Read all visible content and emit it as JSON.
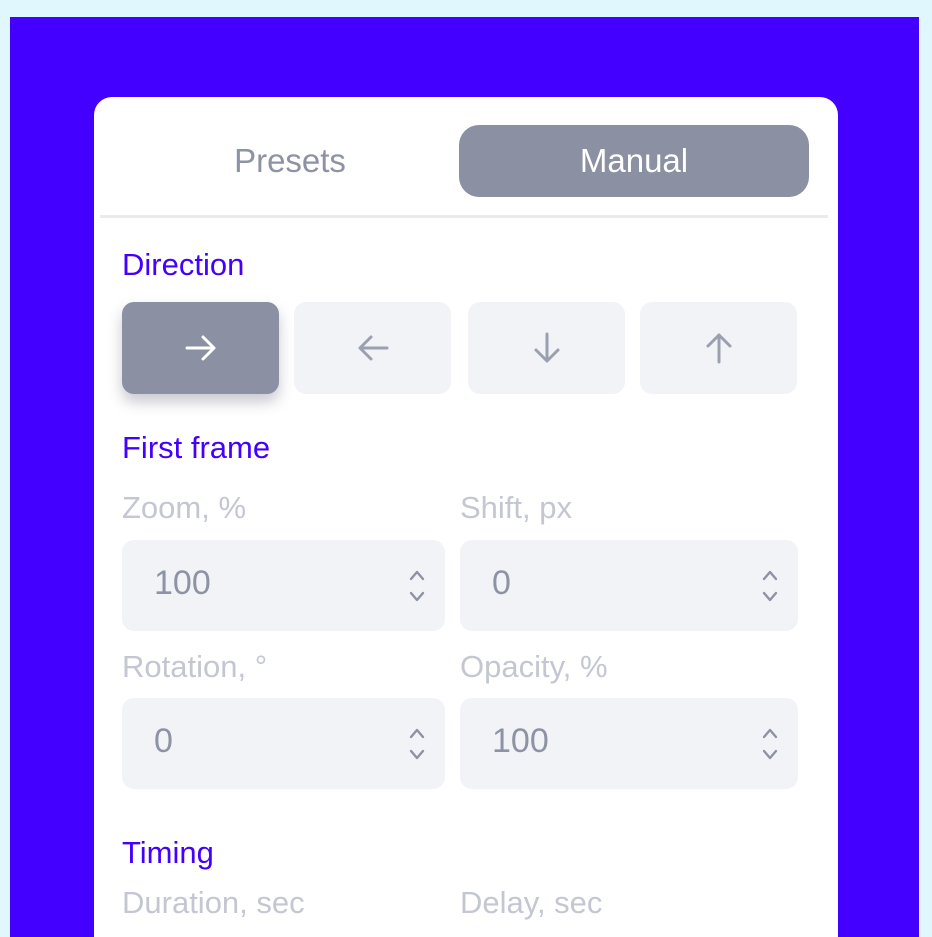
{
  "tabs": {
    "presets": "Presets",
    "manual": "Manual",
    "active": "manual"
  },
  "direction": {
    "title": "Direction",
    "buttons": [
      {
        "icon": "arrow-right-icon",
        "active": true
      },
      {
        "icon": "arrow-left-icon",
        "active": false
      },
      {
        "icon": "arrow-down-icon",
        "active": false
      },
      {
        "icon": "arrow-up-icon",
        "active": false
      }
    ]
  },
  "first_frame": {
    "title": "First frame",
    "zoom": {
      "label": "Zoom, %",
      "value": "100"
    },
    "shift": {
      "label": "Shift, px",
      "value": "0"
    },
    "rotation": {
      "label": "Rotation, °",
      "value": "0"
    },
    "opacity": {
      "label": "Opacity, %",
      "value": "100"
    }
  },
  "timing": {
    "title": "Timing",
    "duration": {
      "label": "Duration, sec"
    },
    "delay": {
      "label": "Delay, sec"
    }
  },
  "colors": {
    "accent": "#4400ff",
    "active_button": "#8b91a3",
    "field_bg": "#f2f3f6",
    "muted_text": "#c4c7d2"
  }
}
